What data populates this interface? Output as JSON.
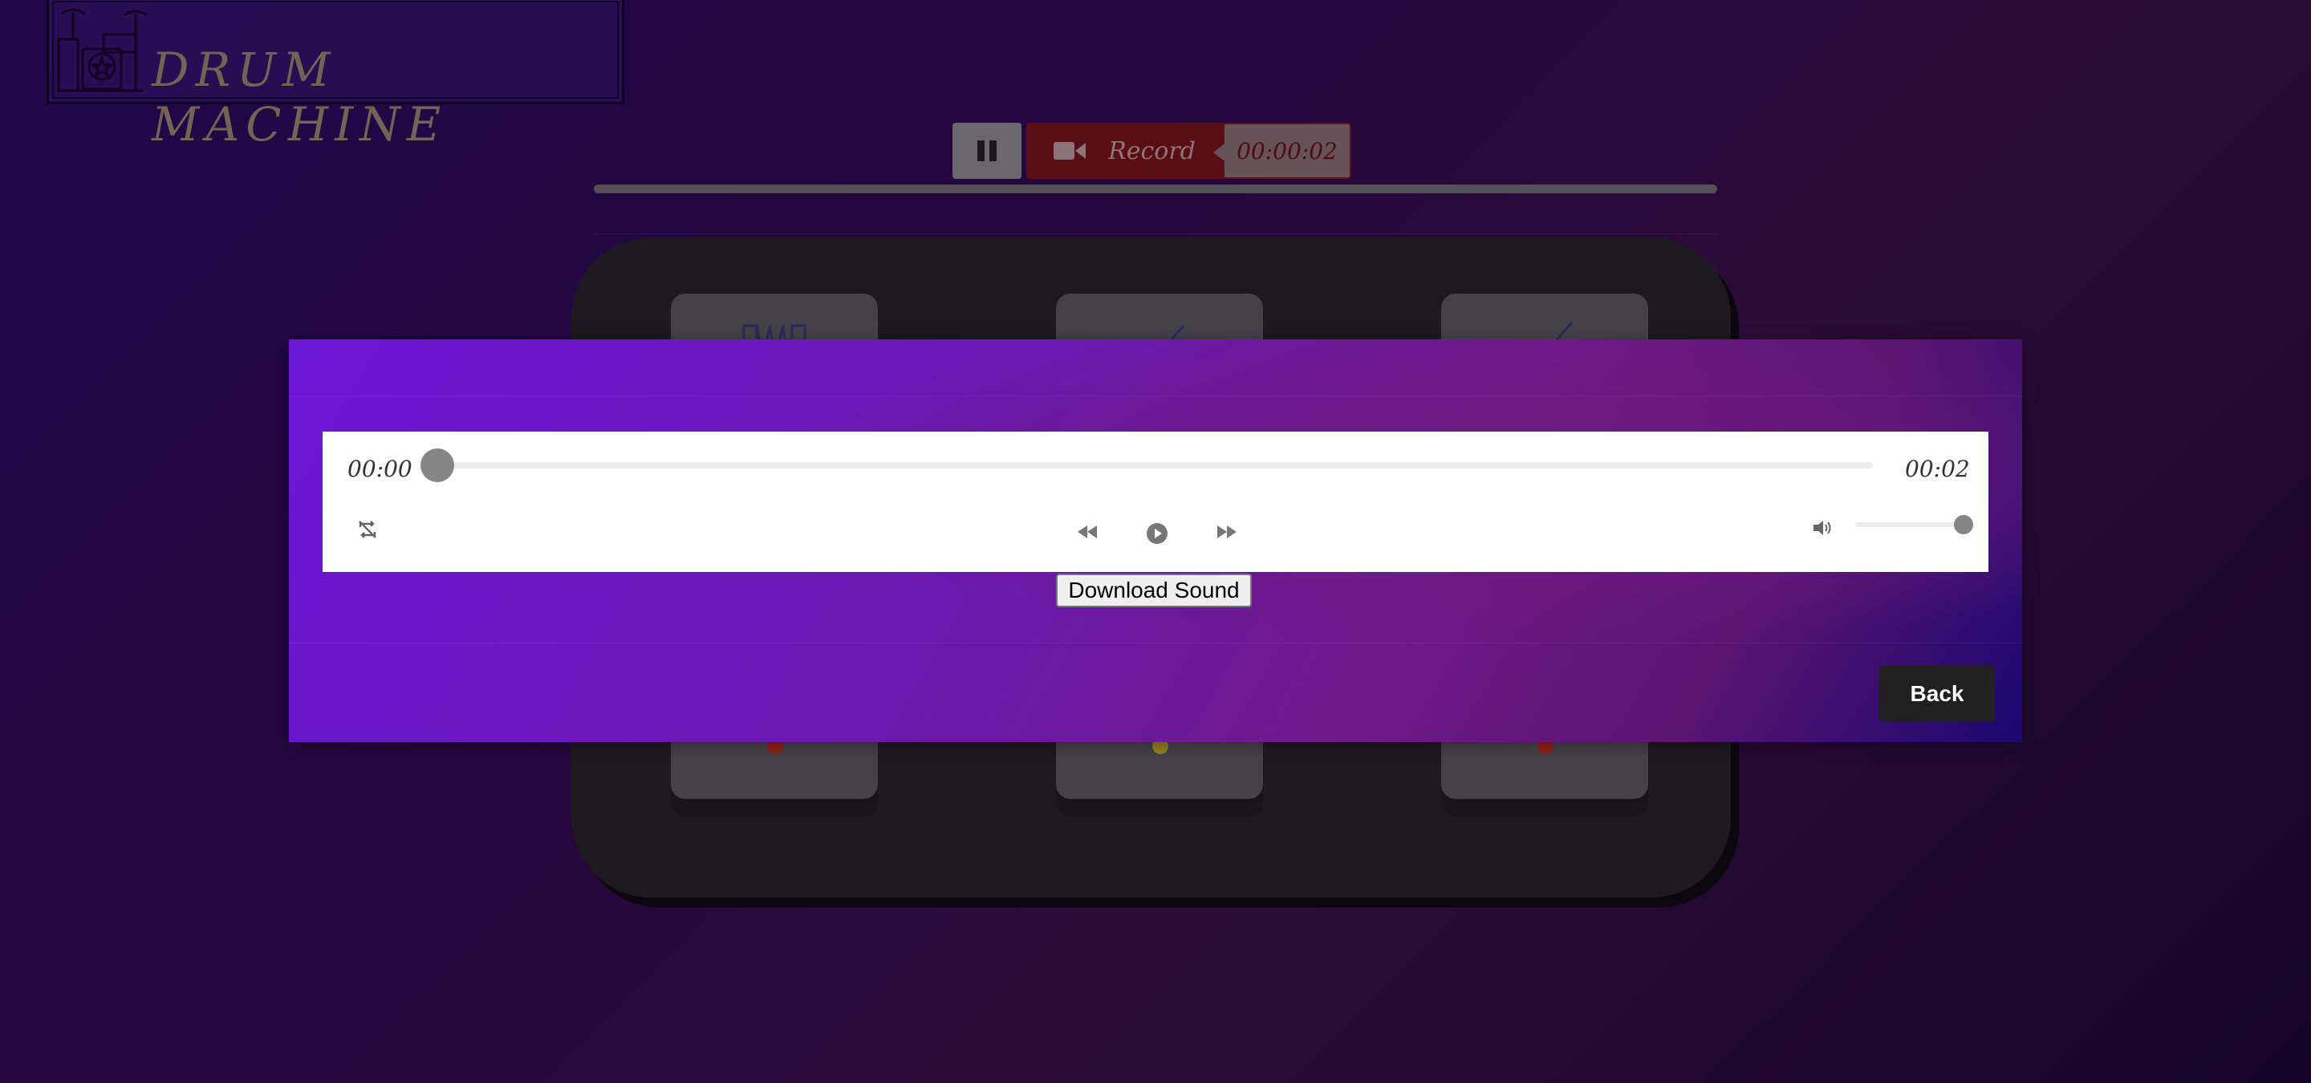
{
  "app": {
    "title": "DRUM MACHINE"
  },
  "recorder": {
    "record_label": "Record",
    "timer": "00:00:02"
  },
  "pads": [
    {
      "icon": "accordion-icon"
    },
    {
      "icon": "guitar-icon"
    },
    {
      "icon": "bass-guitar-icon"
    },
    {
      "icon": "flute-icon",
      "light_color": "#c62a1a"
    },
    {
      "icon": "trumpet-icon",
      "light_color": "#c8b21c"
    },
    {
      "icon": "speaker-icon",
      "light_color": "#c62a1a"
    }
  ],
  "modal": {
    "player": {
      "current_time": "00:00",
      "duration": "00:02",
      "progress_fraction": 0,
      "volume_fraction": 1
    },
    "download_label": "Download Sound",
    "back_label": "Back"
  }
}
